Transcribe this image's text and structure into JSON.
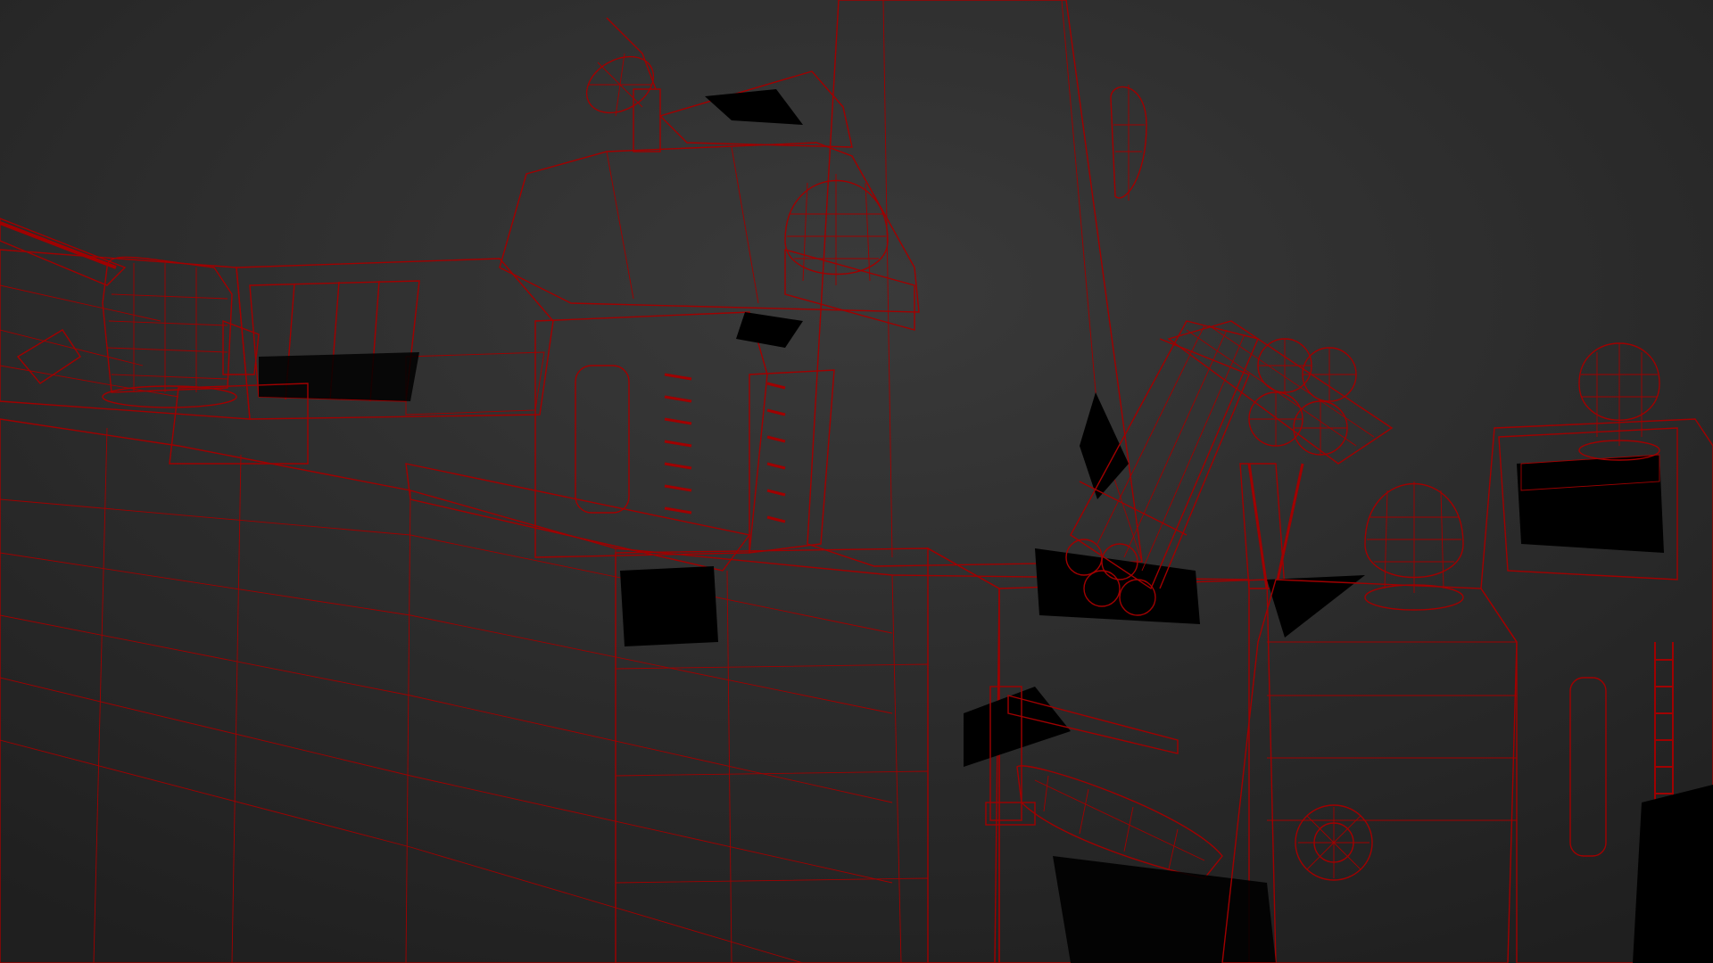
{
  "viewport": {
    "render_mode": "shaded-wireframe",
    "colors": {
      "background_top": "#3a3a3a",
      "background_bottom": "#1f1f1f",
      "surface_light": "#b4b4b4",
      "surface_mid": "#9a9a9a",
      "surface_dark": "#7c7c7c",
      "shadow": "#000000",
      "wireframe": "#a00000"
    }
  }
}
